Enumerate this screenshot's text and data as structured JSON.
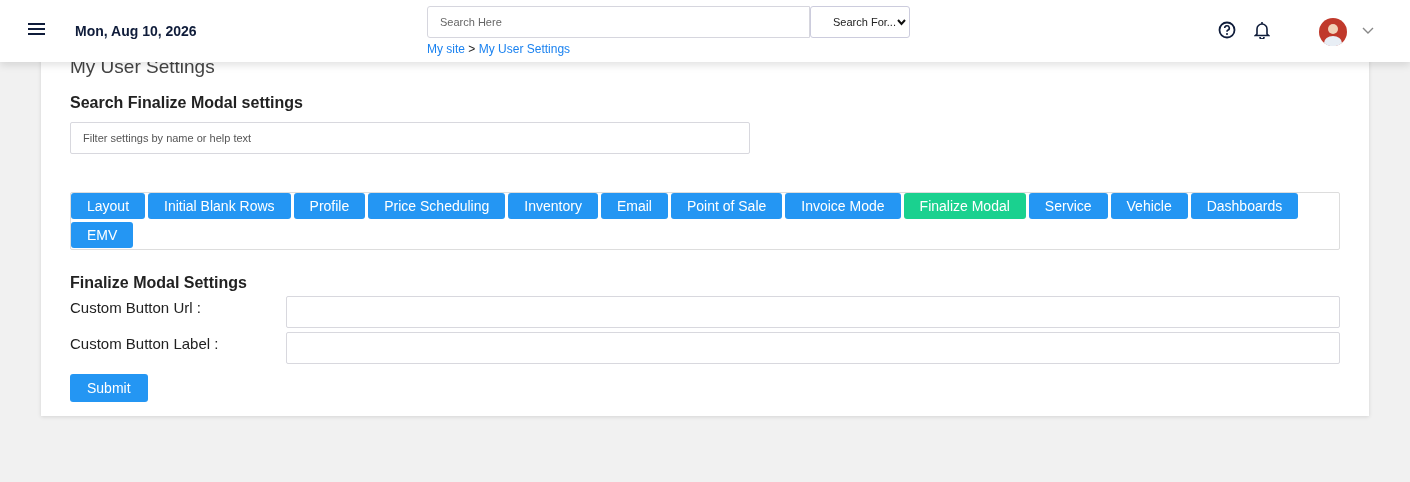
{
  "header": {
    "date": "Mon, Aug 10, 2026",
    "search": {
      "placeholder": "Search Here"
    },
    "search_type": "Search For...",
    "breadcrumb": [
      "My site",
      "My User Settings"
    ],
    "breadcrumb_separator": ">"
  },
  "page_title": "My User Settings",
  "filter": {
    "heading": "Search Finalize Modal settings",
    "placeholder": "Filter settings by name or help text"
  },
  "tabs": [
    {
      "label": "Layout",
      "selected": false
    },
    {
      "label": "Initial Blank Rows",
      "selected": false
    },
    {
      "label": "Profile",
      "selected": false
    },
    {
      "label": "Price Scheduling",
      "selected": false
    },
    {
      "label": "Inventory",
      "selected": false
    },
    {
      "label": "Email",
      "selected": false
    },
    {
      "label": "Point of Sale",
      "selected": false
    },
    {
      "label": "Invoice Mode",
      "selected": false
    },
    {
      "label": "Finalize Modal",
      "selected": true
    },
    {
      "label": "Service",
      "selected": false
    },
    {
      "label": "Vehicle",
      "selected": false
    },
    {
      "label": "Dashboards",
      "selected": false
    },
    {
      "label": "EMV",
      "selected": false
    }
  ],
  "section": {
    "heading": "Finalize Modal Settings",
    "fields": [
      {
        "label": "Custom Button Url :"
      },
      {
        "label": "Custom Button Label :"
      }
    ],
    "submit": "Submit"
  }
}
